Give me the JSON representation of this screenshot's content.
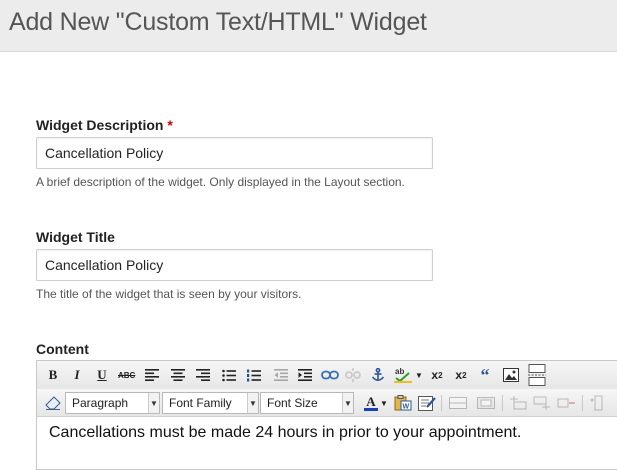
{
  "header": {
    "title": "Add New \"Custom Text/HTML\" Widget"
  },
  "description": {
    "label": "Widget Description",
    "required_marker": "*",
    "value": "Cancellation Policy",
    "hint": "A brief description of the widget. Only displayed in the Layout section."
  },
  "title_field": {
    "label": "Widget Title",
    "value": "Cancellation Policy",
    "hint": "The title of the widget that is seen by your visitors."
  },
  "content": {
    "label": "Content",
    "toolbar": {
      "bold": "B",
      "italic": "I",
      "underline": "U",
      "strikethrough": "ABC",
      "superscript": "x",
      "subscript": "x",
      "format_select": "Paragraph",
      "font_family_select": "Font Family",
      "font_size_select": "Font Size",
      "font_color": "A"
    },
    "body_text": "Cancellations must be made 24 hours in prior to your appointment."
  }
}
